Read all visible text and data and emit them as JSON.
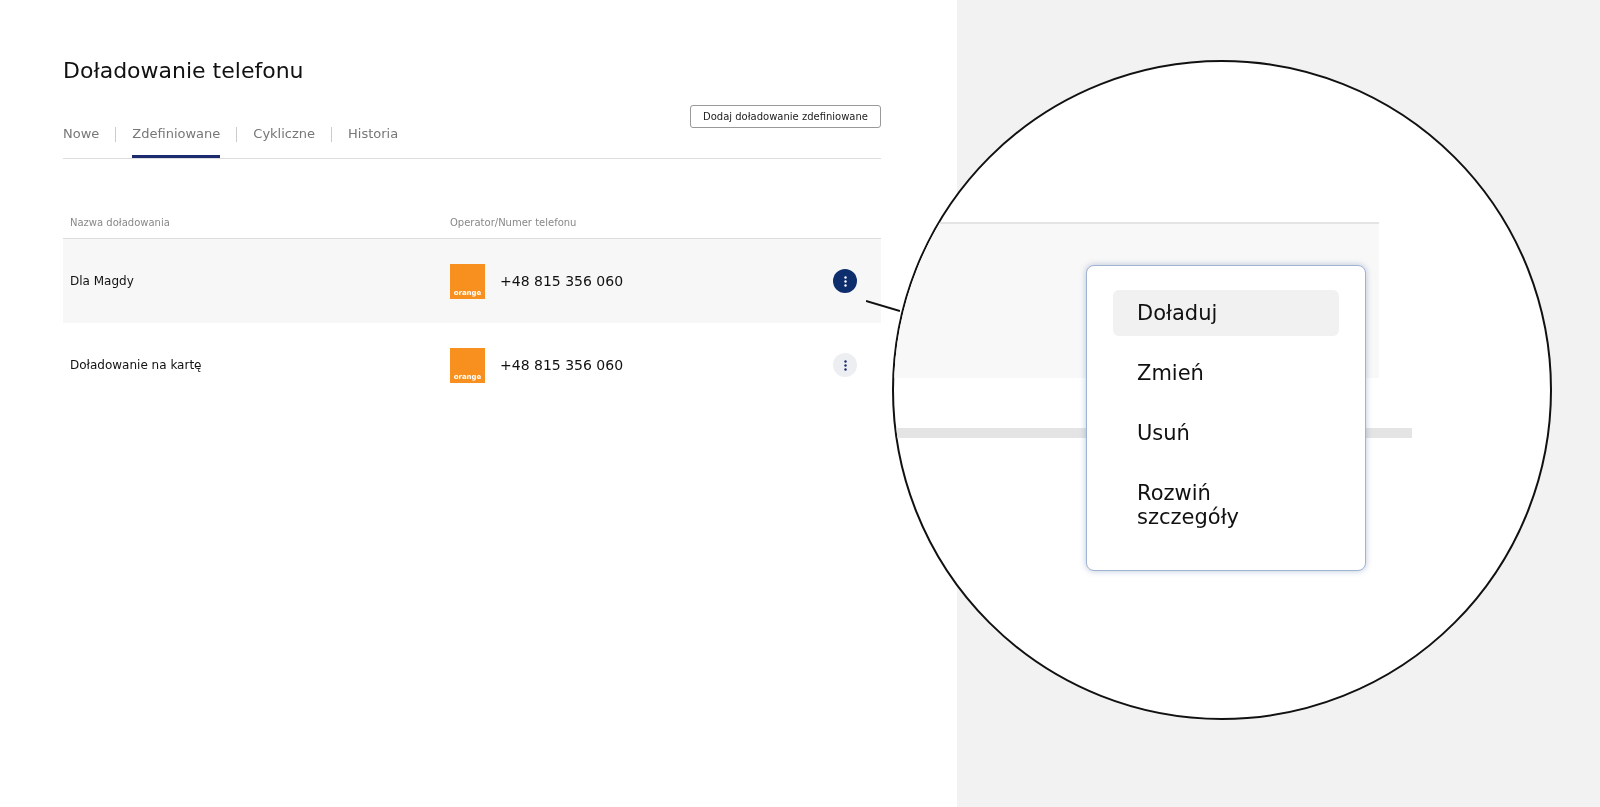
{
  "title": "Doładowanie telefonu",
  "tabs": [
    {
      "label": "Nowe",
      "selected": false
    },
    {
      "label": "Zdefiniowane",
      "selected": true
    },
    {
      "label": "Cykliczne",
      "selected": false
    },
    {
      "label": "Historia",
      "selected": false
    }
  ],
  "add_button": "Dodaj doładowanie zdefiniowane",
  "table": {
    "columns": [
      "Nazwa doładowania",
      "Operator/Numer telefonu"
    ],
    "rows": [
      {
        "name": "Dla Magdy",
        "operator": "orange",
        "phone": "+48 815 356 060",
        "selected": true
      },
      {
        "name": "Doładowanie na kartę",
        "operator": "orange",
        "phone": "+48 815 356 060",
        "selected": false
      }
    ]
  },
  "magnifier": {
    "menu": [
      {
        "label": "Doładuj",
        "selected": true
      },
      {
        "label": "Zmień",
        "selected": false
      },
      {
        "label": "Usuń",
        "selected": false
      },
      {
        "label": "Rozwiń szczegóły",
        "selected": false
      }
    ]
  }
}
